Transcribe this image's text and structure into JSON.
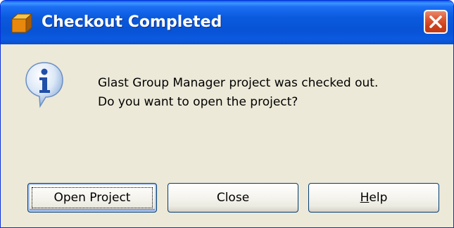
{
  "window": {
    "title": "Checkout Completed",
    "icons": {
      "app": "orange-box-icon",
      "close": "close-icon",
      "message": "information-icon"
    },
    "colors": {
      "titlebar": "#0a59dc",
      "close_button": "#de5a35",
      "background": "#ece9d8"
    }
  },
  "message": {
    "line1": "Glast Group Manager project was checked out.",
    "line2": "Do you want to open the project?"
  },
  "buttons": {
    "open_label": "Open Project",
    "close_label": "Close",
    "help_label": "Help"
  }
}
